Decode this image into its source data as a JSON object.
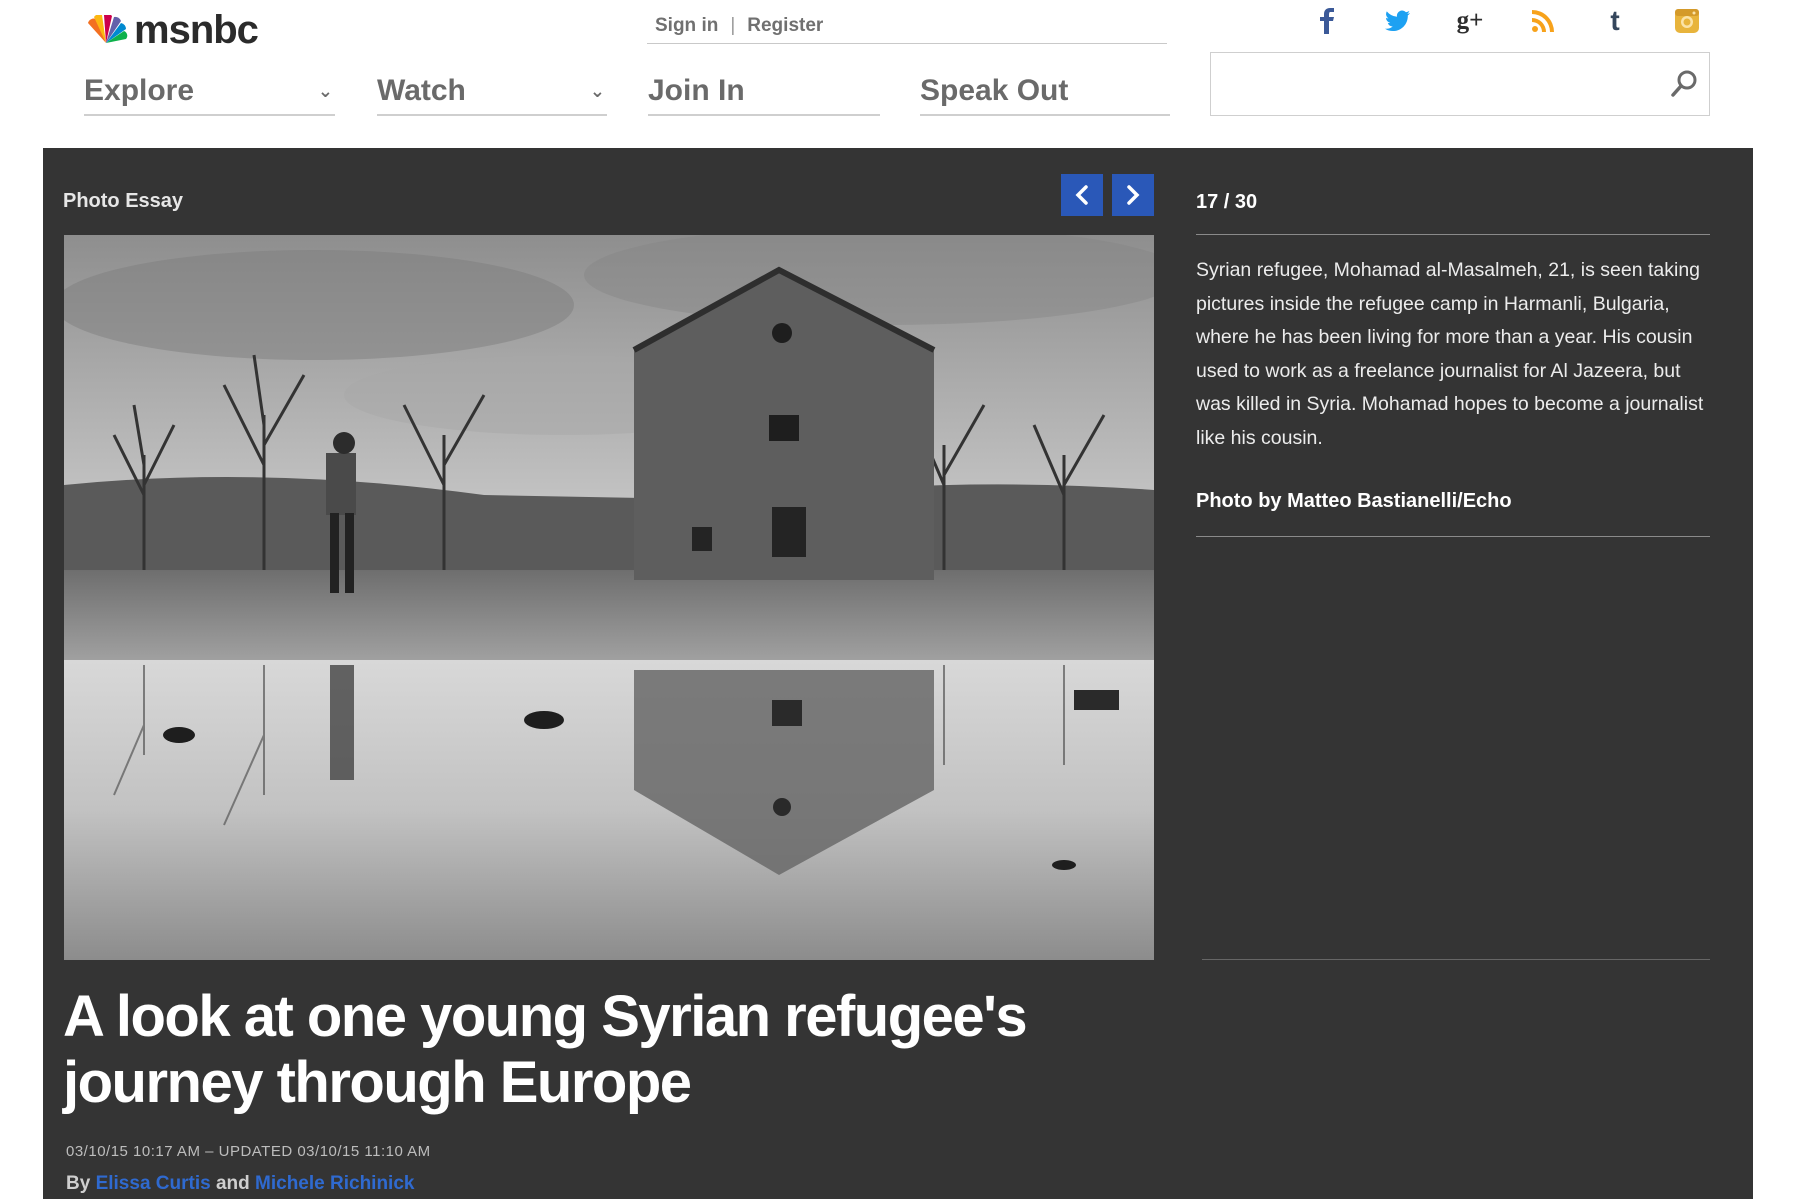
{
  "header": {
    "logo_text": "msnbc",
    "account": {
      "sign_in": "Sign in",
      "separator": "|",
      "register": "Register"
    },
    "social_icons": [
      "facebook-icon",
      "twitter-icon",
      "google-plus-icon",
      "rss-icon",
      "tumblr-icon",
      "instagram-icon"
    ],
    "nav": [
      {
        "label": "Explore",
        "dropdown": true
      },
      {
        "label": "Watch",
        "dropdown": true
      },
      {
        "label": "Join In",
        "dropdown": false
      },
      {
        "label": "Speak Out",
        "dropdown": false
      }
    ],
    "search": {
      "value": "",
      "placeholder": ""
    }
  },
  "essay": {
    "label": "Photo Essay",
    "counter": "17 / 30",
    "caption": "Syrian refugee, Mohamad al-Masalmeh, 21,  is seen taking pictures inside the refugee camp in Harmanli, Bulgaria, where he has been living for more than a year. His cousin used to work as a freelance journalist for Al Jazeera, but was killed in Syria. Mohamad hopes to become a journalist like his cousin.",
    "credit": "Photo by Matteo Bastianelli/Echo",
    "headline": "A look at one young Syrian refugee's journey through Europe",
    "dateline": "03/10/15 10:17 AM – UPDATED 03/10/15 11:10 AM",
    "byline": {
      "prefix": "By",
      "author1": "Elissa Curtis",
      "conjunction": "and",
      "author2": "Michele Richinick"
    }
  },
  "colors": {
    "panel_bg": "#343434",
    "nav_button_blue": "#2a58b8",
    "author_link": "#2f6ad0",
    "facebook": "#3b5998",
    "twitter": "#1da1f2",
    "rss": "#f7a21b",
    "tumblr": "#35465c",
    "instagram": "#e8b43c"
  }
}
